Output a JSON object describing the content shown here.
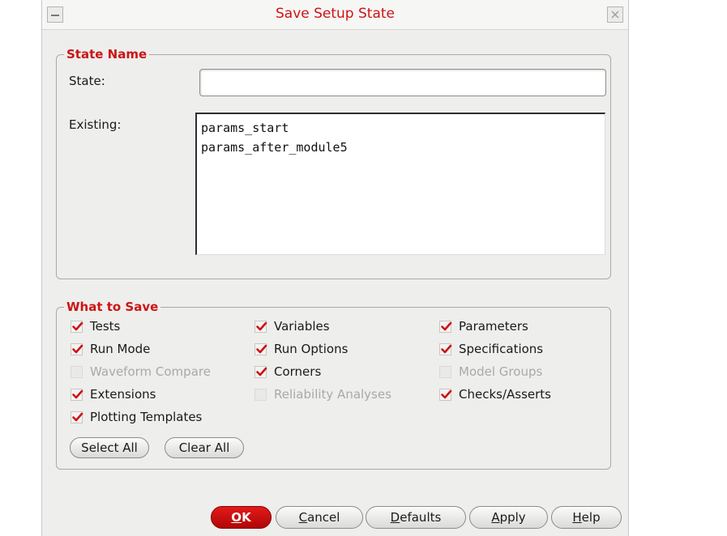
{
  "dialog": {
    "title": "Save Setup State"
  },
  "state_name": {
    "legend": "State Name",
    "state_label": "State:",
    "state_value": "",
    "existing_label": "Existing:",
    "existing": [
      "params_start",
      "params_after_module5"
    ]
  },
  "what_to_save": {
    "legend": "What to Save",
    "options": [
      {
        "label": "Tests",
        "checked": true,
        "enabled": true
      },
      {
        "label": "Variables",
        "checked": true,
        "enabled": true
      },
      {
        "label": "Parameters",
        "checked": true,
        "enabled": true
      },
      {
        "label": "Run Mode",
        "checked": true,
        "enabled": true
      },
      {
        "label": "Run Options",
        "checked": true,
        "enabled": true
      },
      {
        "label": "Specifications",
        "checked": true,
        "enabled": true
      },
      {
        "label": "Waveform Compare",
        "checked": false,
        "enabled": false
      },
      {
        "label": "Corners",
        "checked": true,
        "enabled": true
      },
      {
        "label": "Model Groups",
        "checked": false,
        "enabled": false
      },
      {
        "label": "Extensions",
        "checked": true,
        "enabled": true
      },
      {
        "label": "Reliability Analyses",
        "checked": false,
        "enabled": false
      },
      {
        "label": "Checks/Asserts",
        "checked": true,
        "enabled": true
      },
      {
        "label": "Plotting Templates",
        "checked": true,
        "enabled": true
      }
    ],
    "select_all": "Select All",
    "clear_all": "Clear All"
  },
  "buttons": {
    "ok": {
      "mnemonic": "O",
      "rest": "K"
    },
    "cancel": {
      "mnemonic": "C",
      "rest": "ancel"
    },
    "defaults": {
      "mnemonic": "D",
      "rest": "efaults"
    },
    "apply": {
      "mnemonic": "A",
      "rest": "pply"
    },
    "help": {
      "mnemonic": "H",
      "rest": "elp"
    }
  },
  "colors": {
    "accent": "#cc1414",
    "check": "#cc1414",
    "dialog_bg": "#eeeeec"
  }
}
